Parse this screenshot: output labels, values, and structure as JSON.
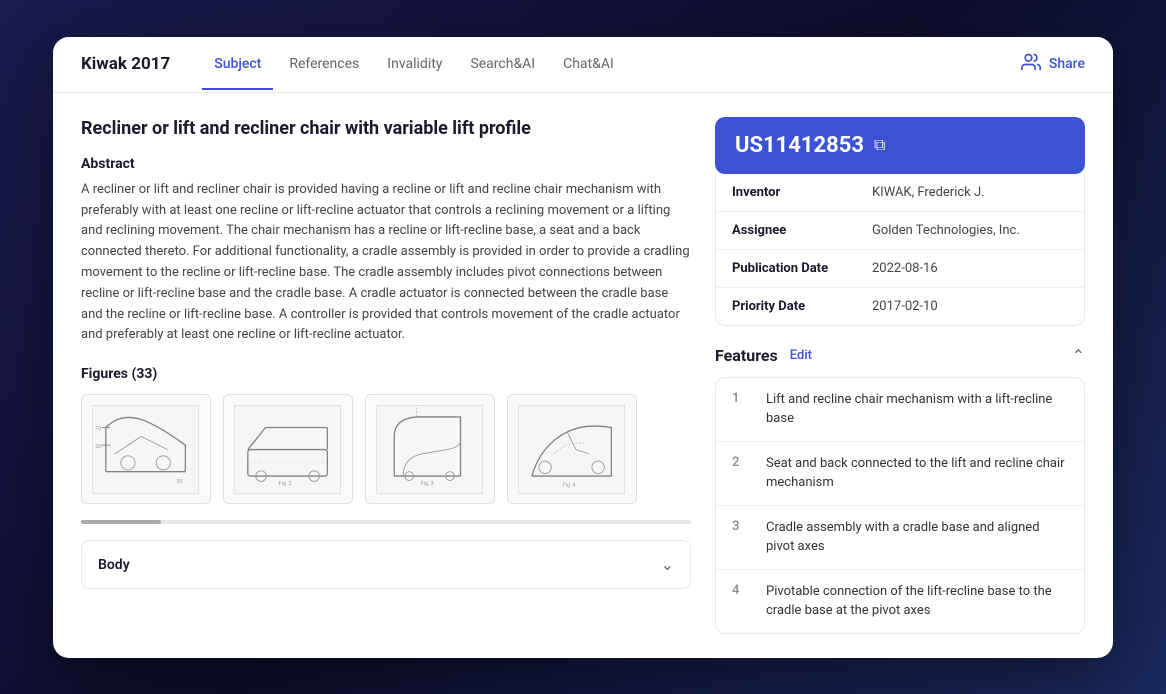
{
  "header": {
    "app_title": "Kiwak 2017",
    "tabs": [
      {
        "label": "Subject",
        "active": true
      },
      {
        "label": "References",
        "active": false
      },
      {
        "label": "Invalidity",
        "active": false
      },
      {
        "label": "Search&AI",
        "active": false
      },
      {
        "label": "Chat&AI",
        "active": false
      }
    ],
    "share_label": "Share"
  },
  "left": {
    "patent_title": "Recliner or lift and recliner chair with variable lift profile",
    "abstract_label": "Abstract",
    "abstract_text": "A recliner or lift and recliner chair is provided having a recline or lift and recline chair mechanism with preferably with at least one recline or lift-recline actuator that controls a reclining movement or a lifting and reclining movement. The chair mechanism has a recline or lift-recline base, a seat and a back connected thereto. For additional functionality, a cradle assembly is provided in order to provide a cradling movement to the recline or lift-recline base. The cradle assembly includes pivot connections between recline or lift-recline base and the cradle base. A cradle actuator is connected between the cradle base and the recline or lift-recline base. A controller is provided that controls movement of the cradle actuator and preferably at least one recline or lift-recline actuator.",
    "figures_label": "Figures (33)",
    "body_label": "Body"
  },
  "right": {
    "patent_id": "US11412853",
    "meta": [
      {
        "key": "Inventor",
        "value": "KIWAK, Frederick J."
      },
      {
        "key": "Assignee",
        "value": "Golden Technologies, Inc."
      },
      {
        "key": "Publication Date",
        "value": "2022-08-16"
      },
      {
        "key": "Priority Date",
        "value": "2017-02-10"
      }
    ],
    "features_title": "Features",
    "edit_label": "Edit",
    "features": [
      {
        "num": "1",
        "text": "Lift and recline chair mechanism with a lift-recline base"
      },
      {
        "num": "2",
        "text": "Seat and back connected to the lift and recline chair mechanism"
      },
      {
        "num": "3",
        "text": "Cradle assembly with a cradle base and aligned pivot axes"
      },
      {
        "num": "4",
        "text": "Pivotable connection of the lift-recline base to the cradle base at the pivot axes"
      }
    ]
  }
}
